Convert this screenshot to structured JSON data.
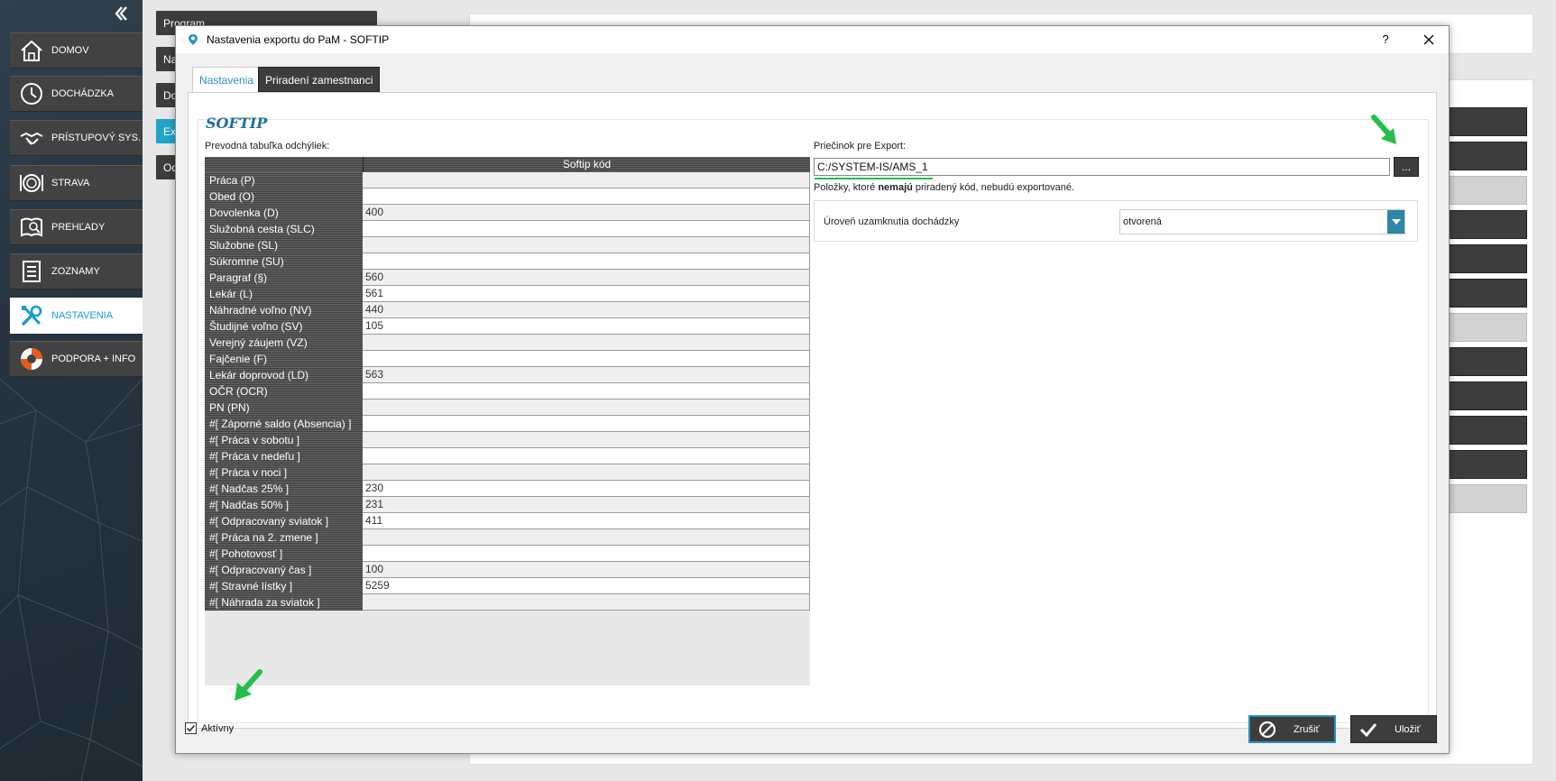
{
  "sidebar": {
    "collapse_icon": "chevron-left-icon",
    "items": [
      {
        "label": "DOMOV",
        "icon": "home-icon"
      },
      {
        "label": "DOCHÁDZKA",
        "icon": "clock-icon"
      },
      {
        "label": "PRÍSTUPOVÝ SYS.",
        "icon": "handshake-icon"
      },
      {
        "label": "STRAVA",
        "icon": "plate-icon"
      },
      {
        "label": "PREHĽADY",
        "icon": "book-search-icon"
      },
      {
        "label": "ZOZNAMY",
        "icon": "list-icon"
      },
      {
        "label": "NASTAVENIA",
        "icon": "tools-icon",
        "active": true
      },
      {
        "label": "PODPORA + INFO",
        "icon": "lifebuoy-icon"
      }
    ]
  },
  "background": {
    "buttons": [
      "Program",
      "Na",
      "Do",
      "Ex",
      "Od"
    ]
  },
  "dialog": {
    "title": "Nastavenia exportu do PaM - SOFTIP",
    "help_label": "?",
    "close_label": "✕",
    "tabs": [
      {
        "label": "Nastavenia",
        "active": true
      },
      {
        "label": "Priradení zamestnanci",
        "active": false
      }
    ],
    "section_title": "SOFTIP",
    "table_label": "Prevodná tabuľka odchýliek:",
    "table": {
      "column_header": "Softip kód",
      "rows": [
        {
          "name": "Práca   (P)",
          "code": ""
        },
        {
          "name": "Obed   (O)",
          "code": ""
        },
        {
          "name": "Dovolenka   (D)",
          "code": "400"
        },
        {
          "name": "Služobná cesta   (SLC)",
          "code": ""
        },
        {
          "name": "Služobne   (SL)",
          "code": ""
        },
        {
          "name": "Súkromne   (SU)",
          "code": ""
        },
        {
          "name": "Paragraf   (§)",
          "code": "560"
        },
        {
          "name": "Lekár   (L)",
          "code": "561"
        },
        {
          "name": "Náhradné voľno   (NV)",
          "code": "440"
        },
        {
          "name": "Študijné voľno   (SV)",
          "code": "105"
        },
        {
          "name": "Verejný záujem   (VZ)",
          "code": ""
        },
        {
          "name": "Fajčenie   (F)",
          "code": ""
        },
        {
          "name": "Lekár doprovod   (LD)",
          "code": "563"
        },
        {
          "name": "OČR   (OCR)",
          "code": ""
        },
        {
          "name": "PN   (PN)",
          "code": ""
        },
        {
          "name": " #[ Záporné saldo (Absencia) ]",
          "code": ""
        },
        {
          "name": " #[ Práca v sobotu ]",
          "code": ""
        },
        {
          "name": " #[ Práca v nedeľu ]",
          "code": ""
        },
        {
          "name": " #[ Práca v noci ]",
          "code": ""
        },
        {
          "name": " #[ Nadčas 25% ]",
          "code": "230"
        },
        {
          "name": " #[ Nadčas 50% ]",
          "code": "231"
        },
        {
          "name": " #[ Odpracovaný sviatok ]",
          "code": "411"
        },
        {
          "name": " #[ Práca na 2. zmene ]",
          "code": ""
        },
        {
          "name": " #[ Pohotovosť ]",
          "code": ""
        },
        {
          "name": " #[ Odpracovaný čas ]",
          "code": "100"
        },
        {
          "name": " #[ Stravné lístky ]",
          "code": "5259"
        },
        {
          "name": " #[ Náhrada za sviatok ]",
          "code": ""
        }
      ]
    },
    "export_folder_label": "Priečinok pre Export:",
    "export_folder_value": "C:/SYSTEM-IS/AMS_1",
    "browse_label": "...",
    "note_prefix": "Položky, ktoré ",
    "note_bold": "nemajú",
    "note_suffix": " priradený kód, nebudú exportované.",
    "lock_label": "Úroveň uzamknutia dochádzky",
    "lock_value": "otvorená",
    "active_checkbox_label": "Aktívny",
    "active_checked": true,
    "cancel_label": "Zrušiť",
    "save_label": "Uložiť"
  },
  "colors": {
    "accent": "#1b9ad3",
    "dark_button": "#3d3d3d",
    "annotation_arrow": "#22c04a"
  }
}
